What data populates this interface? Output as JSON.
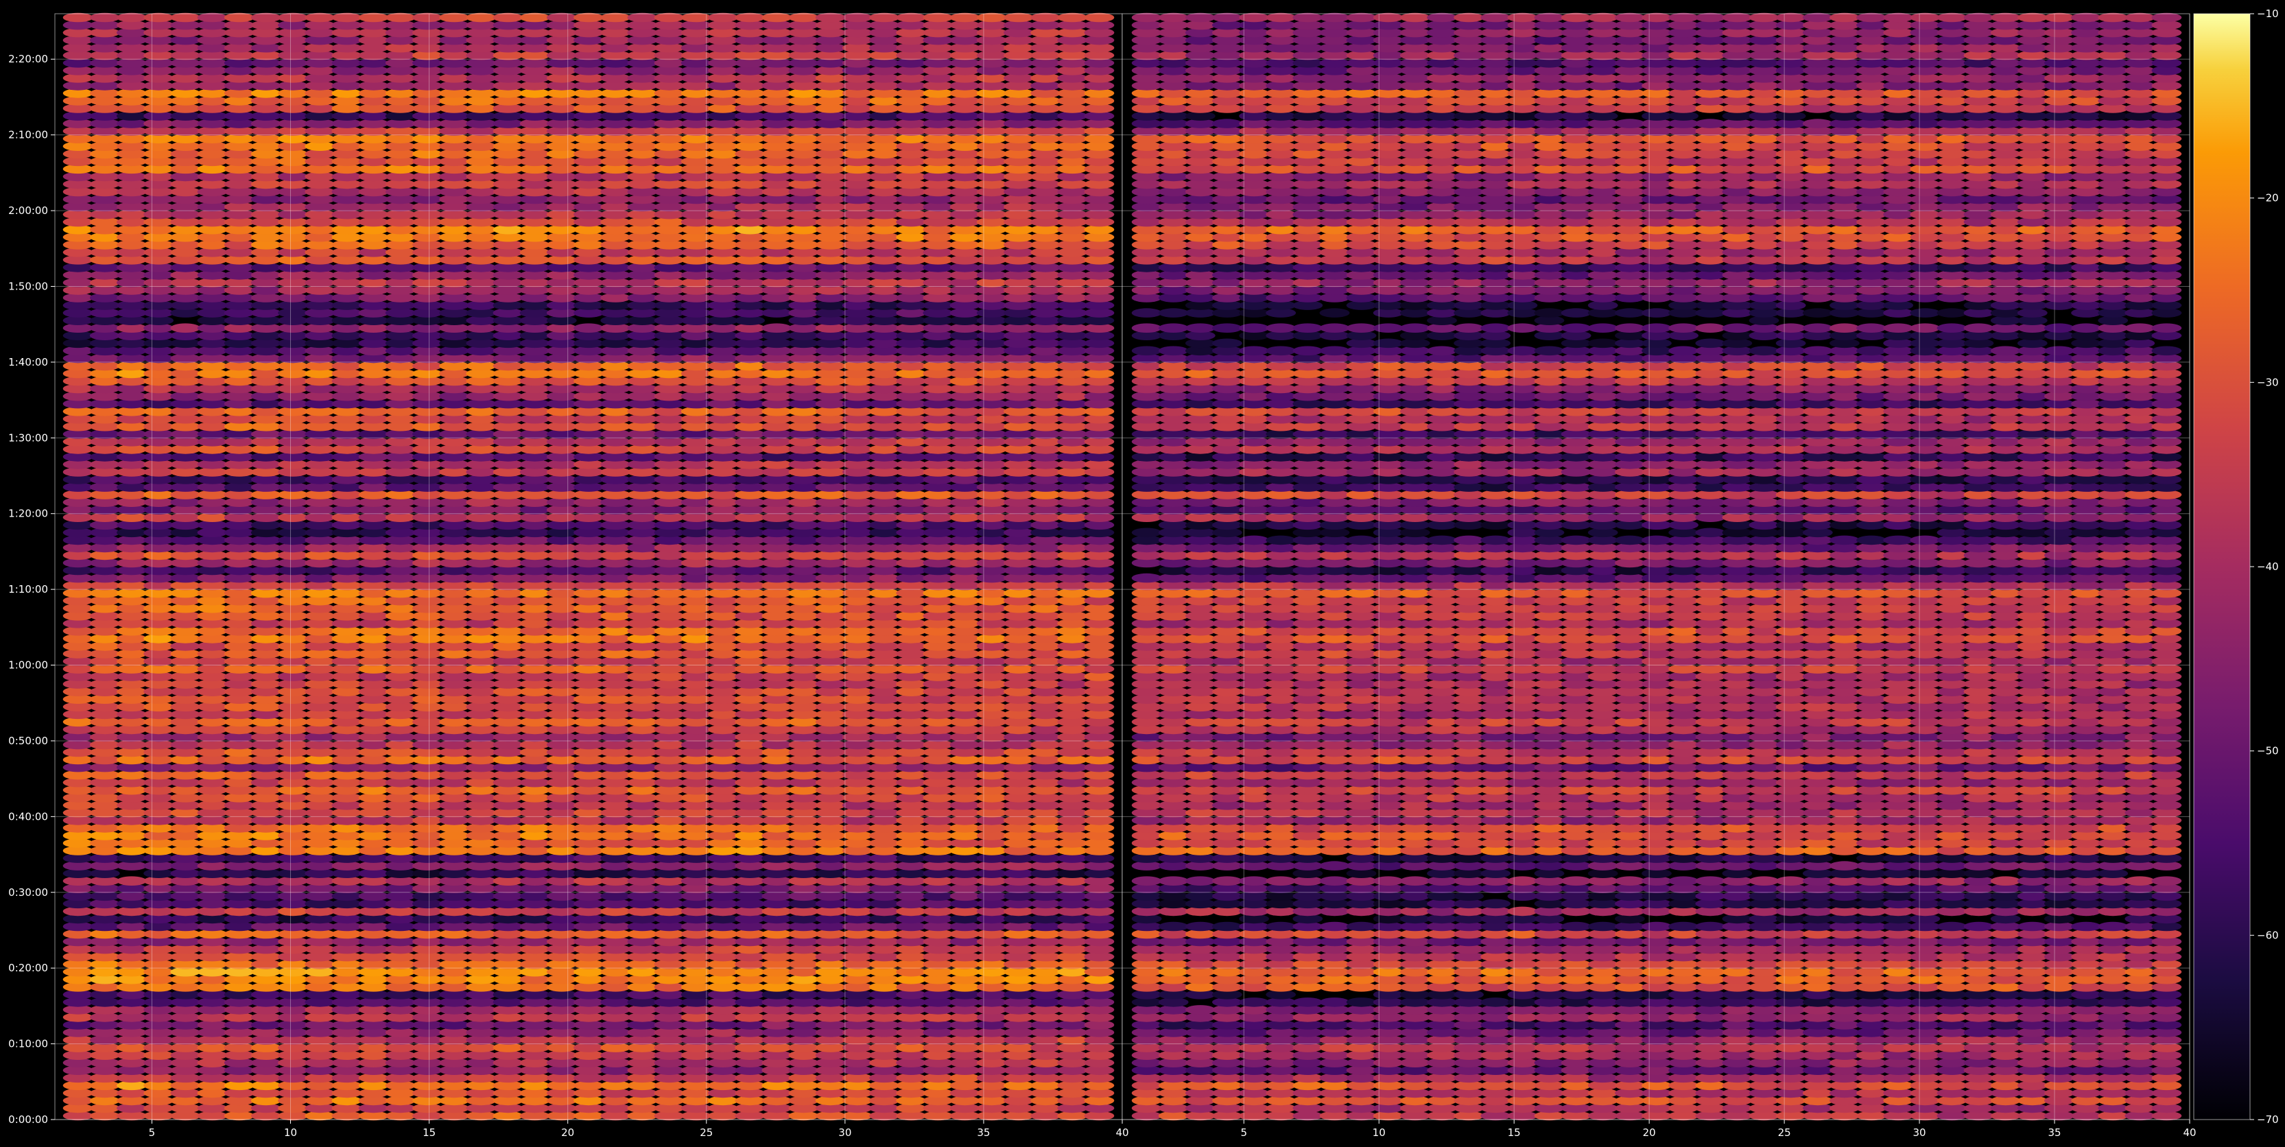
{
  "chart_data": {
    "type": "heatmap",
    "title": "",
    "xlabel": "",
    "ylabel": "",
    "panels": [
      {
        "name": "left",
        "xlim": [
          1.5,
          40
        ],
        "x_ticks": [
          5,
          10,
          15,
          20,
          25,
          30,
          35,
          40
        ],
        "x_tick_labels": [
          "5",
          "10",
          "15",
          "20",
          "25",
          "30",
          "35",
          "40"
        ],
        "columns": 39
      },
      {
        "name": "right",
        "xlim": [
          0.5,
          40
        ],
        "x_ticks": [
          5,
          10,
          15,
          20,
          25,
          30,
          35,
          40
        ],
        "x_tick_labels": [
          "5",
          "10",
          "15",
          "20",
          "25",
          "30",
          "35",
          "40"
        ],
        "columns": 39
      }
    ],
    "y_unit": "elapsed time (h:mm:ss)",
    "ylim_seconds": [
      0,
      8760
    ],
    "y_ticks_seconds": [
      0,
      600,
      1200,
      1800,
      2400,
      3000,
      3600,
      4200,
      4800,
      5400,
      6000,
      6600,
      7200,
      7800,
      8400
    ],
    "y_tick_labels": [
      "0:00:00",
      "0:10:00",
      "0:20:00",
      "0:30:00",
      "0:40:00",
      "0:50:00",
      "1:00:00",
      "1:10:00",
      "1:20:00",
      "1:30:00",
      "1:40:00",
      "1:50:00",
      "2:00:00",
      "2:10:00",
      "2:20:00"
    ],
    "grid": true,
    "colorscale": "inferno",
    "colorbar": {
      "range": [
        -70,
        -10
      ],
      "ticks": [
        -70,
        -60,
        -50,
        -40,
        -30,
        -20,
        -10
      ],
      "tick_labels": [
        "−70",
        "−60",
        "−50",
        "−40",
        "−30",
        "−20",
        "−10"
      ]
    },
    "band_step_seconds": 60,
    "row_levels_dB": [
      -28,
      -32,
      -24,
      -30,
      -22,
      -35,
      -45,
      -40,
      -33,
      -29,
      -38,
      -45,
      -50,
      -37,
      -42,
      -55,
      -58,
      -22,
      -20,
      -19,
      -24,
      -30,
      -36,
      -44,
      -25,
      -52,
      -60,
      -33,
      -57,
      -55,
      -48,
      -40,
      -62,
      -46,
      -58,
      -21,
      -25,
      -23,
      -24,
      -37,
      -30,
      -34,
      -30,
      -26,
      -34,
      -28,
      -45,
      -25,
      -30,
      -38,
      -42,
      -31,
      -27,
      -35,
      -30,
      -29,
      -30,
      -32,
      -36,
      -27,
      -32,
      -27,
      -30,
      -23,
      -24,
      -35,
      -28,
      -26,
      -27,
      -22,
      -31,
      -47,
      -55,
      -43,
      -30,
      -44,
      -52,
      -60,
      -56,
      -34,
      -48,
      -42,
      -26,
      -53,
      -56,
      -36,
      -40,
      -54,
      -31,
      -38,
      -52,
      -28,
      -32,
      -26,
      -52,
      -44,
      -39,
      -28,
      -23,
      -25,
      -48,
      -53,
      -60,
      -58,
      -45,
      -64,
      -57,
      -60,
      -47,
      -42,
      -38,
      -45,
      -54,
      -28,
      -33,
      -26,
      -22,
      -20,
      -30,
      -38,
      -42,
      -45,
      -40,
      -35,
      -39,
      -23,
      -28,
      -25,
      -24,
      -22,
      -36,
      -48,
      -58,
      -28,
      -25,
      -21,
      -42,
      -38,
      -45,
      -50,
      -36,
      -40,
      -44,
      -39,
      -42,
      -35
    ],
    "right_panel_offset_dB": -6,
    "drift_across_columns_dB": 3
  }
}
